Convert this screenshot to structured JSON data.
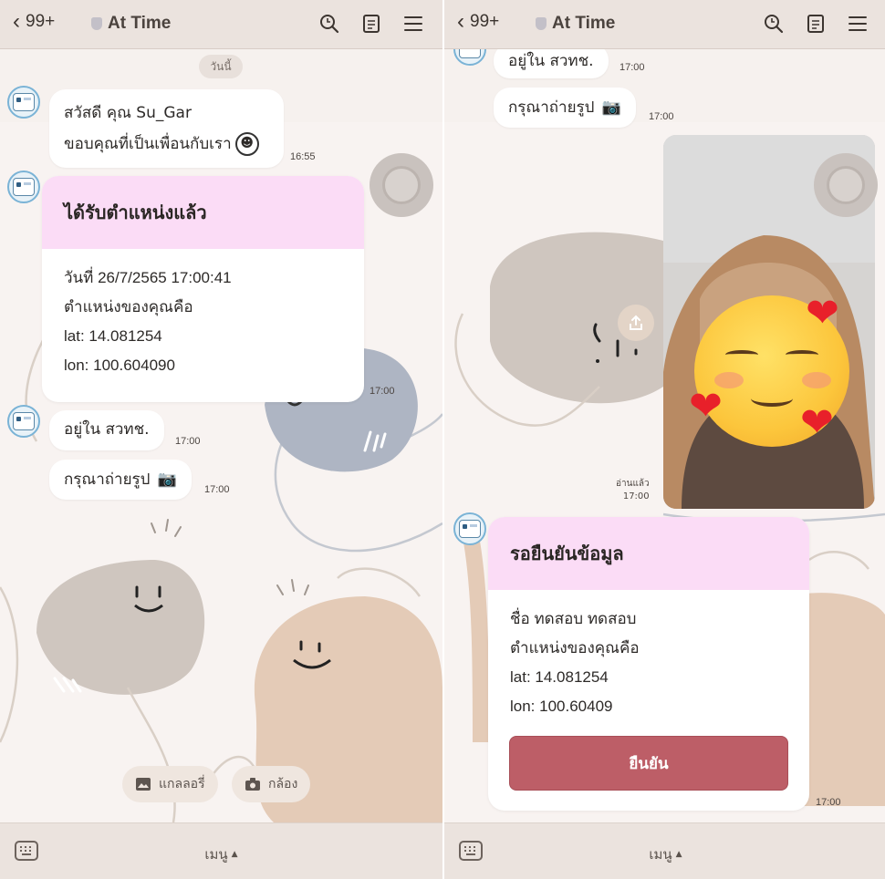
{
  "header": {
    "back_count": "99+",
    "title": "At Time"
  },
  "left": {
    "date_chip": "วันนี้",
    "greeting": {
      "line1": "สวัสดี คุณ Su_Gar",
      "line2": "ขอบคุณที่เป็นเพื่อนกับเรา",
      "time": "16:55"
    },
    "location_card": {
      "title": "ได้รับตำแหน่งแล้ว",
      "date_line": "วันที่ 26/7/2565 17:00:41",
      "location_line": "ตำแหน่งของคุณคือ",
      "lat": "lat: 14.081254",
      "lon": "lon: 100.604090",
      "time": "17:00"
    },
    "msg_location": {
      "text": "อยู่ใน สวทช.",
      "time": "17:00"
    },
    "msg_photo": {
      "text": "กรุณาถ่ายรูป",
      "time": "17:00"
    },
    "quick_replies": {
      "gallery": "แกลลอรี่",
      "camera": "กล้อง"
    }
  },
  "right": {
    "msg_location": {
      "text": "อยู่ใน สวทช.",
      "time": "17:00"
    },
    "msg_photo": {
      "text": "กรุณาถ่ายรูป",
      "time": "17:00"
    },
    "photo_status": {
      "read": "อ่านแล้ว",
      "time": "17:00"
    },
    "verify_card": {
      "title": "รอยืนยันข้อมูล",
      "name_line": "ชื่อ ทดสอบ ทดสอบ",
      "location_line": "ตำแหน่งของคุณคือ",
      "lat": "lat: 14.081254",
      "lon": "lon: 100.60409",
      "button": "ยืนยัน",
      "time": "17:00"
    }
  },
  "bottom": {
    "menu": "เมนู"
  }
}
